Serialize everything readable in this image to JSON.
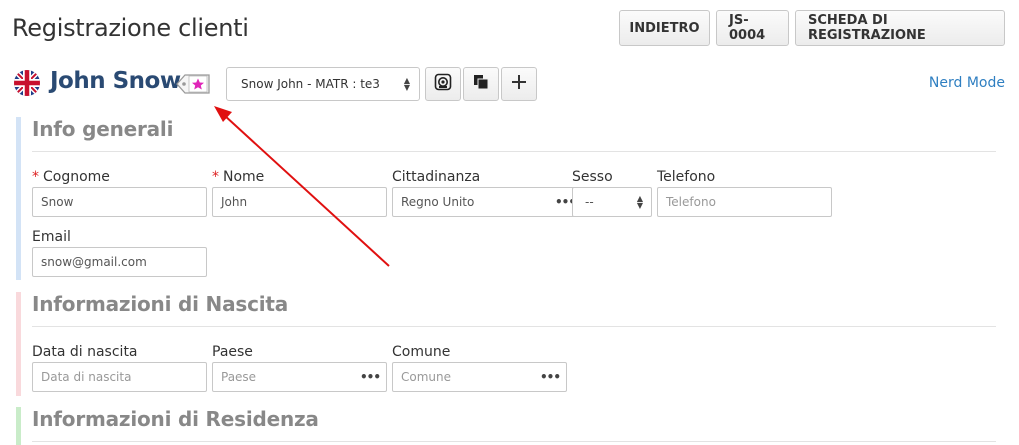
{
  "header": {
    "title": "Registrazione clienti",
    "buttons": {
      "back": "INDIETRO",
      "code": "JS-0004",
      "registration_sheet": "SCHEDA DI REGISTRAZIONE"
    }
  },
  "patient": {
    "flag_icon": "uk-flag-icon",
    "name": "John Snow",
    "tag_icon": "star-tag-icon",
    "selector_value": "Snow John - MATR : te3",
    "actions": [
      "camera-icon",
      "copy-icon",
      "plus-icon"
    ]
  },
  "nerd_mode": "Nerd Mode",
  "sections": {
    "info": {
      "title": "Info generali",
      "accent": "#cfe0f5",
      "fields": {
        "surname": {
          "required": "*",
          "label": "Cognome",
          "value": "Snow"
        },
        "name": {
          "required": "*",
          "label": "Nome",
          "value": "John"
        },
        "citizenship": {
          "label": "Cittadinanza",
          "value": "Regno Unito"
        },
        "sex": {
          "label": "Sesso",
          "value": "--"
        },
        "phone": {
          "label": "Telefono",
          "placeholder": "Telefono"
        },
        "email": {
          "label": "Email",
          "value": "snow@gmail.com"
        }
      }
    },
    "birth": {
      "title": "Informazioni di Nascita",
      "accent": "#f8d7da",
      "fields": {
        "birth_date": {
          "label": "Data di nascita",
          "placeholder": "Data di nascita"
        },
        "country": {
          "label": "Paese",
          "placeholder": "Paese"
        },
        "city": {
          "label": "Comune",
          "placeholder": "Comune"
        }
      }
    },
    "residence": {
      "title": "Informazioni di Residenza",
      "accent": "#c8ebc8"
    }
  },
  "annotation": {
    "arrow_color": "#e01010"
  }
}
